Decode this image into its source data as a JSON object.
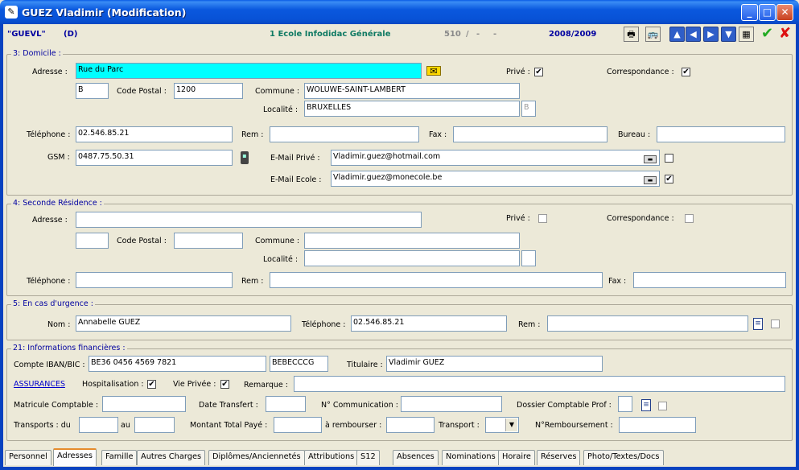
{
  "window": {
    "title": "GUEZ Vladimir (Modification)"
  },
  "infobar": {
    "code": "\"GUEVL\"",
    "tag": "(D)",
    "school": "1 Ecole Infodidac Générale",
    "number": "510",
    "sep1": "/",
    "dash1": "-",
    "dash2": "-",
    "year": "2008/2009"
  },
  "domicile": {
    "legend": "3: Domicile :",
    "adresse_label": "Adresse :",
    "adresse": "Rue du Parc",
    "prive_label": "Privé :",
    "prive_checked": "✔",
    "corr_label": "Correspondance :",
    "corr_checked": "✔",
    "box": "B",
    "cp_label": "Code Postal :",
    "cp": "1200",
    "commune_label": "Commune :",
    "commune": "WOLUWE-SAINT-LAMBERT",
    "localite_label": "Localité :",
    "localite": "BRUXELLES",
    "localite_code": "B",
    "tel_label": "Téléphone :",
    "tel": "02.546.85.21",
    "rem_label": "Rem :",
    "rem": "",
    "fax_label": "Fax :",
    "fax": "",
    "bureau_label": "Bureau :",
    "bureau": "",
    "gsm_label": "GSM :",
    "gsm": "0487.75.50.31",
    "email_prive_label": "E-Mail Privé :",
    "email_prive": "Vladimir.guez@hotmail.com",
    "email_ecole_label": "E-Mail Ecole :",
    "email_ecole": "Vladimir.guez@monecole.be",
    "email_ecole_checked": "✔"
  },
  "seconde": {
    "legend": "4: Seconde Résidence :",
    "adresse_label": "Adresse :",
    "prive_label": "Privé :",
    "corr_label": "Correspondance :",
    "cp_label": "Code Postal :",
    "commune_label": "Commune :",
    "localite_label": "Localité :",
    "tel_label": "Téléphone :",
    "rem_label": "Rem :",
    "fax_label": "Fax :"
  },
  "urgence": {
    "legend": "5: En cas d'urgence :",
    "nom_label": "Nom :",
    "nom": "Annabelle GUEZ",
    "tel_label": "Téléphone :",
    "tel": "02.546.85.21",
    "rem_label": "Rem :",
    "rem": ""
  },
  "finances": {
    "legend": "21: Informations financières :",
    "iban_label": "Compte IBAN/BIC :",
    "iban": "BE36 0456 4569 7821",
    "bic": "BEBECCCG",
    "titulaire_label": "Titulaire :",
    "titulaire": "Vladimir GUEZ",
    "assurances_link": "ASSURANCES",
    "hosp_label": "Hospitalisation :",
    "hosp_checked": "✔",
    "vie_label": "Vie Privée :",
    "vie_checked": "✔",
    "remarque_label": "Remarque :",
    "matricule_label": "Matricule Comptable :",
    "date_transfert_label": "Date Transfert :",
    "ncomm_label": "N° Communication :",
    "dossier_label": "Dossier Comptable Prof :",
    "transports_label": "Transports : du",
    "au_label": "au",
    "montant_label": "Montant Total Payé :",
    "rembourser_label": "à rembourser :",
    "transport_label": "Transport :",
    "nremb_label": "N°Remboursement :"
  },
  "tabs": [
    "Personnel",
    "Adresses",
    "Famille",
    "Autres Charges",
    "Diplômes/Anciennetés",
    "Attributions",
    "S12",
    "Absences",
    "Nominations",
    "Horaire",
    "Réserves",
    "Photo/Textes/Docs"
  ],
  "colors": {
    "titlebar": "#0a58de",
    "highlight_field": "#00ffff",
    "label_blue": "#0000a0",
    "school_green": "#0f7a63"
  },
  "icons": [
    "app-icon",
    "minimize-icon",
    "maximize-icon",
    "close-icon",
    "printer-icon",
    "bus-icon",
    "arrow-up-icon",
    "arrow-left-icon",
    "arrow-right-icon",
    "arrow-down-icon",
    "calculator-icon",
    "check-icon",
    "cancel-icon",
    "envelope-icon",
    "phone-icon",
    "document-icon"
  ]
}
